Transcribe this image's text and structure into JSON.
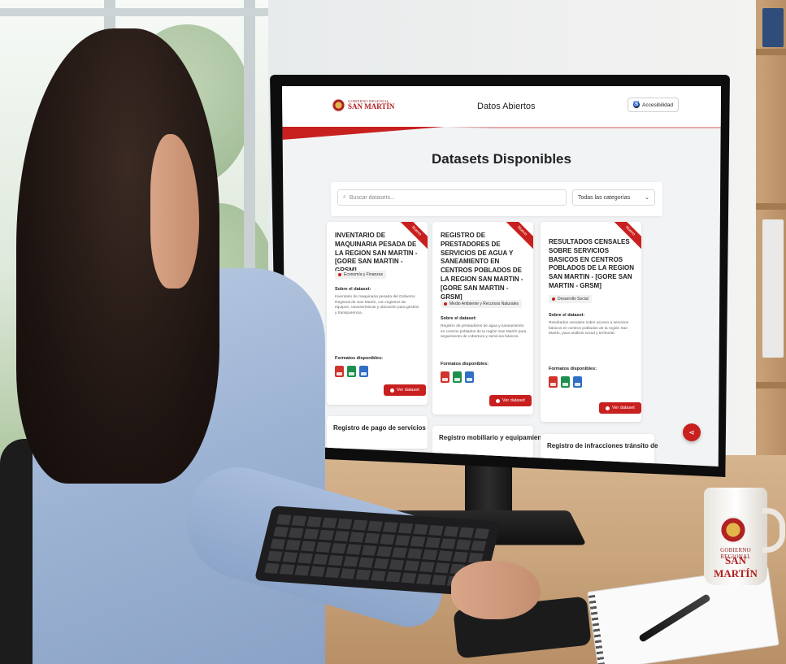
{
  "site": {
    "logo_line1": "GOBIERNO REGIONAL",
    "logo_line2": "SAN MARTÍN",
    "title": "Datos Abiertos",
    "accessibility_label": "Accesibilidad"
  },
  "page": {
    "heading": "Datasets Disponibles",
    "search_placeholder": "Buscar datasets...",
    "category_selected": "Todas las categorías"
  },
  "cards": [
    {
      "badge": "Nuevo",
      "title": "INVENTARIO DE MAQUINARIA PESADA DE LA REGION SAN MARTIN - [GORE SAN MARTIN - GRSM]",
      "category": "Economía y Finanzas",
      "about_label": "Sobre el dataset:",
      "about_text": "Inventario de maquinaria pesada del Gobierno Regional de San Martín, con registros de equipos, características y ubicación para gestión y transparencia.",
      "formats_label": "Formatos disponibles:",
      "formats": [
        "pdf",
        "xls",
        "doc"
      ],
      "view_label": "Ver dataset"
    },
    {
      "badge": "Nuevo",
      "title": "REGISTRO DE PRESTADORES DE SERVICIOS DE AGUA Y SANEAMIENTO EN CENTROS POBLADOS DE LA REGION SAN MARTIN - [GORE SAN MARTIN - GRSM]",
      "category": "Medio Ambiente y Recursos Naturales",
      "about_label": "Sobre el dataset:",
      "about_text": "Registro de prestadores de agua y saneamiento en centros poblados de la región San Martín para seguimiento de cobertura y servicios básicos.",
      "formats_label": "Formatos disponibles:",
      "formats": [
        "pdf",
        "xls",
        "doc"
      ],
      "view_label": "Ver dataset"
    },
    {
      "badge": "Nuevo",
      "title": "RESULTADOS CENSALES SOBRE SERVICIOS BASICOS EN CENTROS POBLADOS DE LA REGION SAN MARTIN - [GORE SAN MARTIN - GRSM]",
      "category": "Desarrollo Social",
      "about_label": "Sobre el dataset:",
      "about_text": "Resultados censales sobre acceso a servicios básicos en centros poblados de la región San Martín, para análisis social y territorial.",
      "formats_label": "Formatos disponibles:",
      "formats": [
        "pdf",
        "xls",
        "doc"
      ],
      "view_label": "Ver dataset"
    }
  ],
  "more_cards": [
    {
      "title": "Registro de pago de servicios"
    },
    {
      "title": "Registro mobiliario y equipamiento"
    },
    {
      "title": "Registro de infracciones tránsito de"
    }
  ],
  "share_icon": "share-icon",
  "mug": {
    "line1": "GOBIERNO REGIONAL",
    "line2": "SAN MARTÍN"
  },
  "colors": {
    "brand_red": "#c8201f",
    "pdf": "#d0342c",
    "xls": "#1f8f4d",
    "doc": "#2f6fc7"
  }
}
